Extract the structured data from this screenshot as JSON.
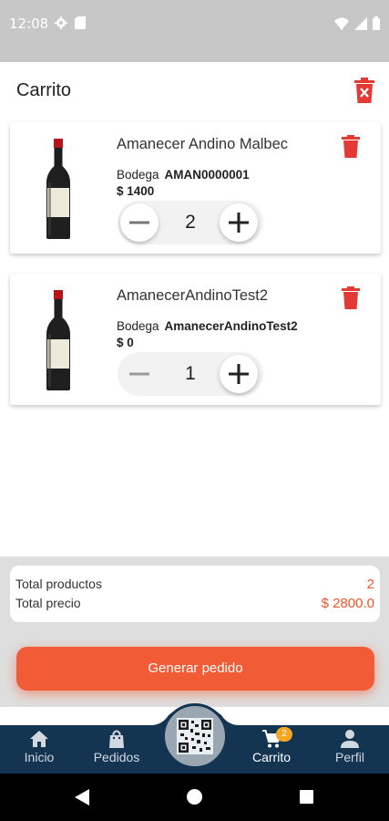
{
  "status_bar": {
    "time": "12:08",
    "icons": [
      "gear-icon",
      "sd-card-icon",
      "wifi-icon",
      "signal-icon",
      "battery-icon"
    ]
  },
  "header": {
    "title": "Carrito",
    "delete_icon": "trash-x-icon"
  },
  "colors": {
    "accent": "#f15b35",
    "delete": "#e53935",
    "nav_bg": "#143552",
    "badge": "#f5a623"
  },
  "cart": {
    "items": [
      {
        "name": "Amanecer Andino Malbec",
        "bodega_label": "Bodega",
        "bodega_value": "AMAN0000001",
        "price": "$ 1400",
        "quantity": "2"
      },
      {
        "name": "AmanecerAndinoTest2",
        "bodega_label": "Bodega",
        "bodega_value": "AmanecerAndinoTest2",
        "price": "$ 0",
        "quantity": "1"
      }
    ]
  },
  "summary": {
    "total_products_label": "Total productos",
    "total_products_value": "2",
    "total_price_label": "Total precio",
    "total_price_value": "$ 2800.0"
  },
  "actions": {
    "generate_label": "Generar pedido"
  },
  "nav": {
    "items": [
      {
        "label": "Inicio",
        "icon": "home-icon"
      },
      {
        "label": "Pedidos",
        "icon": "shopping-bag-icon"
      },
      {
        "label": "Carrito",
        "icon": "cart-icon",
        "badge": "2",
        "active": true
      },
      {
        "label": "Perfil",
        "icon": "person-icon"
      }
    ],
    "center_icon": "qr-code-icon"
  }
}
